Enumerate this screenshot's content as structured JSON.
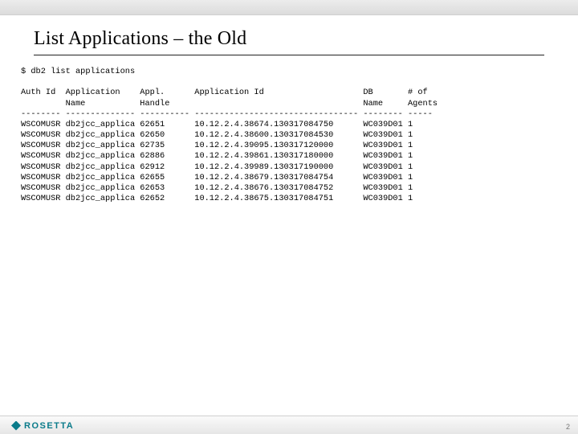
{
  "title": "List Applications – the Old",
  "command": "$ db2 list applications",
  "headers": {
    "auth_id": "Auth Id",
    "app_name_1": "Application",
    "app_name_2": "Name",
    "handle_1": "Appl.",
    "handle_2": "Handle",
    "app_id": "Application Id",
    "db_1": "DB",
    "db_2": "Name",
    "agents_1": "# of",
    "agents_2": "Agents"
  },
  "rows": [
    {
      "auth": "WSCOMUSR",
      "app": "db2jcc_applica",
      "handle": "62651",
      "id": "10.12.2.4.38674.130317084750",
      "db": "WC039D01",
      "agents": "1"
    },
    {
      "auth": "WSCOMUSR",
      "app": "db2jcc_applica",
      "handle": "62650",
      "id": "10.12.2.4.38600.130317084530",
      "db": "WC039D01",
      "agents": "1"
    },
    {
      "auth": "WSCOMUSR",
      "app": "db2jcc_applica",
      "handle": "62735",
      "id": "10.12.2.4.39095.130317120000",
      "db": "WC039D01",
      "agents": "1"
    },
    {
      "auth": "WSCOMUSR",
      "app": "db2jcc_applica",
      "handle": "62886",
      "id": "10.12.2.4.39861.130317180000",
      "db": "WC039D01",
      "agents": "1"
    },
    {
      "auth": "WSCOMUSR",
      "app": "db2jcc_applica",
      "handle": "62912",
      "id": "10.12.2.4.39989.130317190000",
      "db": "WC039D01",
      "agents": "1"
    },
    {
      "auth": "WSCOMUSR",
      "app": "db2jcc_applica",
      "handle": "62655",
      "id": "10.12.2.4.38679.130317084754",
      "db": "WC039D01",
      "agents": "1"
    },
    {
      "auth": "WSCOMUSR",
      "app": "db2jcc_applica",
      "handle": "62653",
      "id": "10.12.2.4.38676.130317084752",
      "db": "WC039D01",
      "agents": "1"
    },
    {
      "auth": "WSCOMUSR",
      "app": "db2jcc_applica",
      "handle": "62652",
      "id": "10.12.2.4.38675.130317084751",
      "db": "WC039D01",
      "agents": "1"
    }
  ],
  "logo_text": "ROSETTA",
  "page_number": "2"
}
